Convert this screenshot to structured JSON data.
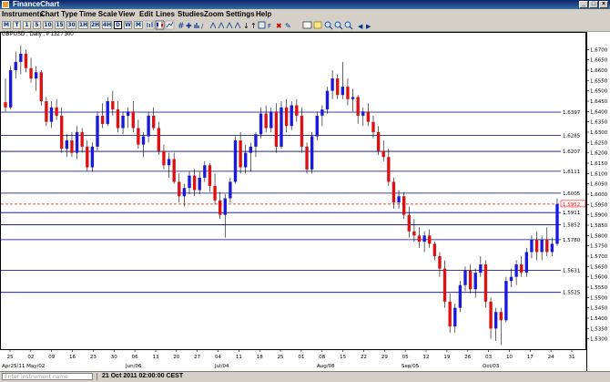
{
  "window": {
    "title": "FinanceChart"
  },
  "menu": [
    "Instruments",
    "Chart Type",
    "Time Scale",
    "View",
    "Edit",
    "Lines",
    "Studies",
    "Zoom",
    "Settings",
    "Help"
  ],
  "toolbar": [
    "M",
    "T",
    "1",
    "5",
    "10",
    "15",
    "30",
    "1H",
    "2H",
    "4H",
    "D",
    "W",
    "M"
  ],
  "toolbar_selected": "D",
  "symbol_info": "GBPUSD , Daily , # 132 / 300",
  "status": {
    "instrument_placeholder": "Enter instrument name",
    "datetime": "21 Oct 2011 02:00:00 CEST"
  },
  "colors": {
    "up": "#1a1adc",
    "down": "#dd1111",
    "line": "#000080",
    "current": "#ff0000"
  },
  "chart_data": {
    "type": "candlestick",
    "ylim": [
      1.525,
      1.675
    ],
    "y_ticks": [
      "1.6700",
      "1.6650",
      "1.6600",
      "1.6550",
      "1.6500",
      "1.6450",
      "1.6400",
      "1.6350",
      "1.6300",
      "1.6250",
      "1.6200",
      "1.6150",
      "1.6100",
      "1.6050",
      "1.6000",
      "1.5950",
      "1.5900",
      "1.5850",
      "1.5800",
      "1.5750",
      "1.5700",
      "1.5650",
      "1.5600",
      "1.5550",
      "1.5500",
      "1.5450",
      "1.5400",
      "1.5350",
      "1.5300"
    ],
    "x_day_labels": [
      "25",
      "02",
      "09",
      "16",
      "23",
      "30",
      "06",
      "13",
      "20",
      "27",
      "04",
      "11",
      "18",
      "25",
      "01",
      "08",
      "15",
      "22",
      "29",
      "05",
      "12",
      "19",
      "26",
      "03",
      "10",
      "17",
      "24",
      "31"
    ],
    "x_month_labels": [
      "Apr25/11 May/02",
      "Jun/06",
      "Jul/04",
      "Aug/08",
      "Sep/05",
      "Oct/03"
    ],
    "horizontal_lines": [
      "1.6397",
      "1.6285",
      "1.6207",
      "1.6111",
      "1.6005",
      "1.5952",
      "1.5911",
      "1.5852",
      "1.5780",
      "1.5631",
      "1.5525"
    ],
    "current_price": "1.5952",
    "ohlc": [
      [
        1.6445,
        1.656,
        1.64,
        1.642
      ],
      [
        1.642,
        1.662,
        1.641,
        1.66
      ],
      [
        1.66,
        1.669,
        1.656,
        1.664
      ],
      [
        1.664,
        1.672,
        1.658,
        1.668
      ],
      [
        1.668,
        1.67,
        1.659,
        1.661
      ],
      [
        1.661,
        1.666,
        1.654,
        1.656
      ],
      [
        1.656,
        1.662,
        1.65,
        1.659
      ],
      [
        1.659,
        1.66,
        1.643,
        1.645
      ],
      [
        1.645,
        1.647,
        1.633,
        1.635
      ],
      [
        1.635,
        1.645,
        1.632,
        1.642
      ],
      [
        1.642,
        1.646,
        1.636,
        1.638
      ],
      [
        1.638,
        1.642,
        1.62,
        1.622
      ],
      [
        1.622,
        1.629,
        1.618,
        1.626
      ],
      [
        1.626,
        1.63,
        1.618,
        1.62
      ],
      [
        1.62,
        1.633,
        1.617,
        1.63
      ],
      [
        1.63,
        1.632,
        1.62,
        1.623
      ],
      [
        1.623,
        1.626,
        1.611,
        1.613
      ],
      [
        1.613,
        1.625,
        1.611,
        1.623
      ],
      [
        1.623,
        1.64,
        1.621,
        1.638
      ],
      [
        1.638,
        1.644,
        1.632,
        1.634
      ],
      [
        1.634,
        1.647,
        1.633,
        1.645
      ],
      [
        1.645,
        1.65,
        1.638,
        1.641
      ],
      [
        1.641,
        1.645,
        1.63,
        1.632
      ],
      [
        1.632,
        1.64,
        1.629,
        1.638
      ],
      [
        1.638,
        1.642,
        1.632,
        1.64
      ],
      [
        1.64,
        1.645,
        1.63,
        1.632
      ],
      [
        1.632,
        1.636,
        1.622,
        1.624
      ],
      [
        1.624,
        1.63,
        1.618,
        1.628
      ],
      [
        1.628,
        1.64,
        1.625,
        1.638
      ],
      [
        1.638,
        1.642,
        1.631,
        1.632
      ],
      [
        1.632,
        1.635,
        1.619,
        1.621
      ],
      [
        1.621,
        1.624,
        1.612,
        1.614
      ],
      [
        1.614,
        1.62,
        1.608,
        1.617
      ],
      [
        1.617,
        1.62,
        1.605,
        1.606
      ],
      [
        1.606,
        1.61,
        1.596,
        1.599
      ],
      [
        1.599,
        1.605,
        1.594,
        1.603
      ],
      [
        1.603,
        1.611,
        1.6,
        1.609
      ],
      [
        1.609,
        1.612,
        1.599,
        1.602
      ],
      [
        1.602,
        1.611,
        1.6,
        1.608
      ],
      [
        1.608,
        1.616,
        1.606,
        1.614
      ],
      [
        1.614,
        1.615,
        1.601,
        1.604
      ],
      [
        1.604,
        1.61,
        1.595,
        1.597
      ],
      [
        1.597,
        1.601,
        1.588,
        1.59
      ],
      [
        1.59,
        1.6,
        1.579,
        1.598
      ],
      [
        1.598,
        1.608,
        1.596,
        1.606
      ],
      [
        1.606,
        1.628,
        1.605,
        1.626
      ],
      [
        1.626,
        1.63,
        1.61,
        1.613
      ],
      [
        1.613,
        1.624,
        1.61,
        1.62
      ],
      [
        1.62,
        1.625,
        1.611,
        1.623
      ],
      [
        1.623,
        1.63,
        1.618,
        1.629
      ],
      [
        1.629,
        1.642,
        1.627,
        1.639
      ],
      [
        1.639,
        1.643,
        1.63,
        1.632
      ],
      [
        1.632,
        1.642,
        1.63,
        1.64
      ],
      [
        1.64,
        1.644,
        1.62,
        1.623
      ],
      [
        1.623,
        1.645,
        1.622,
        1.642
      ],
      [
        1.642,
        1.646,
        1.63,
        1.633
      ],
      [
        1.633,
        1.645,
        1.631,
        1.643
      ],
      [
        1.643,
        1.646,
        1.635,
        1.638
      ],
      [
        1.638,
        1.642,
        1.62,
        1.623
      ],
      [
        1.623,
        1.625,
        1.61,
        1.612
      ],
      [
        1.612,
        1.63,
        1.61,
        1.628
      ],
      [
        1.628,
        1.64,
        1.626,
        1.638
      ],
      [
        1.638,
        1.643,
        1.633,
        1.641
      ],
      [
        1.641,
        1.652,
        1.639,
        1.65
      ],
      [
        1.65,
        1.66,
        1.646,
        1.656
      ],
      [
        1.656,
        1.658,
        1.646,
        1.648
      ],
      [
        1.648,
        1.664,
        1.646,
        1.652
      ],
      [
        1.652,
        1.656,
        1.643,
        1.646
      ],
      [
        1.646,
        1.651,
        1.64,
        1.647
      ],
      [
        1.647,
        1.648,
        1.634,
        1.638
      ],
      [
        1.638,
        1.642,
        1.633,
        1.64
      ],
      [
        1.64,
        1.644,
        1.633,
        1.635
      ],
      [
        1.635,
        1.638,
        1.627,
        1.63
      ],
      [
        1.63,
        1.633,
        1.619,
        1.621
      ],
      [
        1.621,
        1.626,
        1.616,
        1.618
      ],
      [
        1.618,
        1.622,
        1.604,
        1.606
      ],
      [
        1.606,
        1.608,
        1.593,
        1.596
      ],
      [
        1.596,
        1.602,
        1.593,
        1.599
      ],
      [
        1.599,
        1.601,
        1.588,
        1.59
      ],
      [
        1.59,
        1.594,
        1.579,
        1.582
      ],
      [
        1.582,
        1.588,
        1.577,
        1.58
      ],
      [
        1.58,
        1.584,
        1.574,
        1.577
      ],
      [
        1.577,
        1.582,
        1.572,
        1.58
      ],
      [
        1.58,
        1.583,
        1.574,
        1.576
      ],
      [
        1.576,
        1.577,
        1.568,
        1.57
      ],
      [
        1.57,
        1.572,
        1.56,
        1.564
      ],
      [
        1.564,
        1.568,
        1.545,
        1.548
      ],
      [
        1.548,
        1.552,
        1.533,
        1.536
      ],
      [
        1.536,
        1.547,
        1.533,
        1.545
      ],
      [
        1.545,
        1.558,
        1.543,
        1.556
      ],
      [
        1.556,
        1.565,
        1.553,
        1.563
      ],
      [
        1.563,
        1.566,
        1.552,
        1.554
      ],
      [
        1.554,
        1.564,
        1.55,
        1.562
      ],
      [
        1.562,
        1.57,
        1.56,
        1.566
      ],
      [
        1.566,
        1.568,
        1.545,
        1.548
      ],
      [
        1.548,
        1.55,
        1.53,
        1.535
      ],
      [
        1.535,
        1.545,
        1.529,
        1.543
      ],
      [
        1.543,
        1.545,
        1.527,
        1.539
      ],
      [
        1.539,
        1.56,
        1.538,
        1.558
      ],
      [
        1.558,
        1.564,
        1.555,
        1.56
      ],
      [
        1.56,
        1.568,
        1.556,
        1.566
      ],
      [
        1.566,
        1.57,
        1.56,
        1.562
      ],
      [
        1.562,
        1.574,
        1.56,
        1.572
      ],
      [
        1.572,
        1.58,
        1.569,
        1.578
      ],
      [
        1.578,
        1.582,
        1.568,
        1.572
      ],
      [
        1.572,
        1.58,
        1.568,
        1.578
      ],
      [
        1.578,
        1.584,
        1.57,
        1.572
      ],
      [
        1.572,
        1.579,
        1.57,
        1.576
      ],
      [
        1.576,
        1.598,
        1.575,
        1.5952
      ]
    ]
  }
}
